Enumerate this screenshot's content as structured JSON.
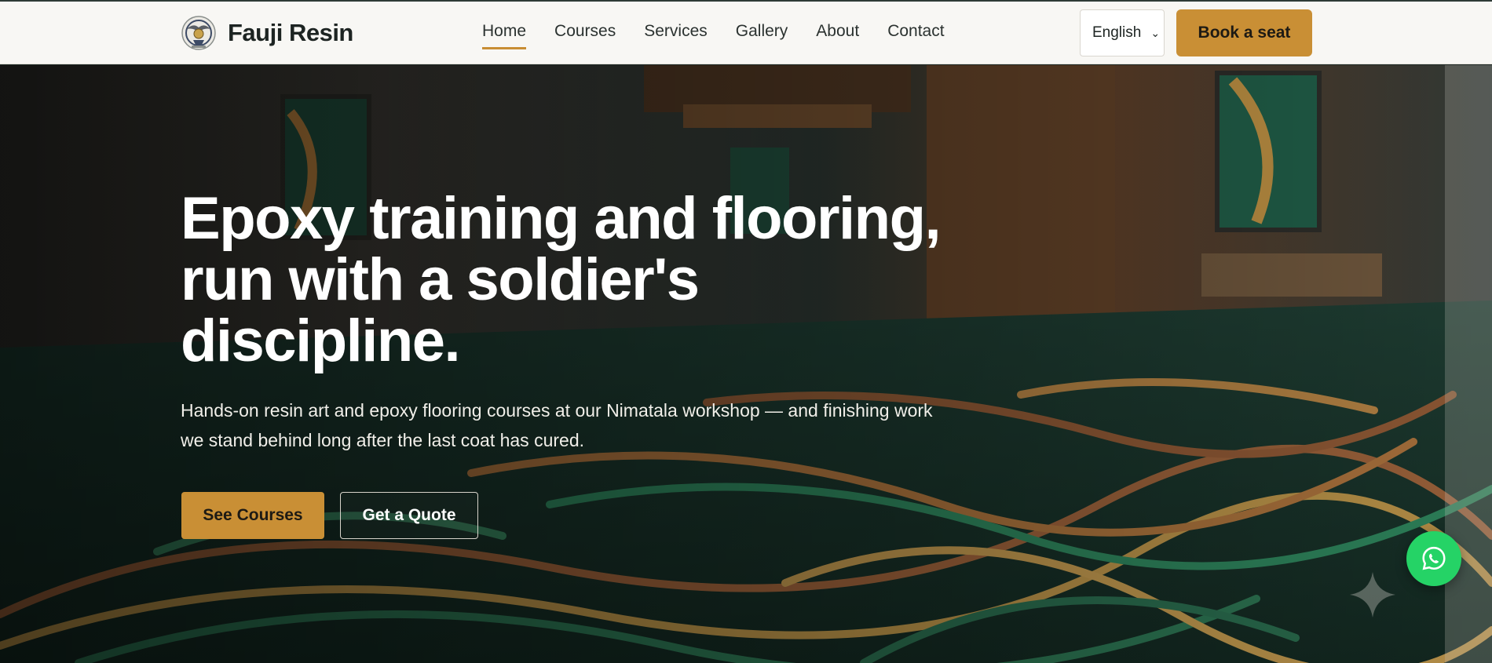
{
  "brand": {
    "name": "Fauji Resin",
    "logo_icon": "military-emblem-icon"
  },
  "nav": {
    "items": [
      {
        "label": "Home",
        "active": true
      },
      {
        "label": "Courses",
        "active": false
      },
      {
        "label": "Services",
        "active": false
      },
      {
        "label": "Gallery",
        "active": false
      },
      {
        "label": "About",
        "active": false
      },
      {
        "label": "Contact",
        "active": false
      }
    ]
  },
  "language": {
    "selected": "English"
  },
  "header_cta": {
    "label": "Book a seat"
  },
  "hero": {
    "title": "Epoxy training and flooring, run with a soldier's discipline.",
    "subtitle": "Hands-on resin art and epoxy flooring courses at our Nimatala workshop — and finishing work we stand behind long after the last coat has cured.",
    "primary_cta": "See Courses",
    "secondary_cta": "Get a Quote"
  },
  "floating": {
    "whatsapp_icon": "whatsapp-icon",
    "sparkle_icon": "sparkle-icon"
  },
  "colors": {
    "accent": "#c98f35",
    "header_bg": "#f8f7f4",
    "text_dark": "#1d2422",
    "whatsapp": "#25d366"
  }
}
